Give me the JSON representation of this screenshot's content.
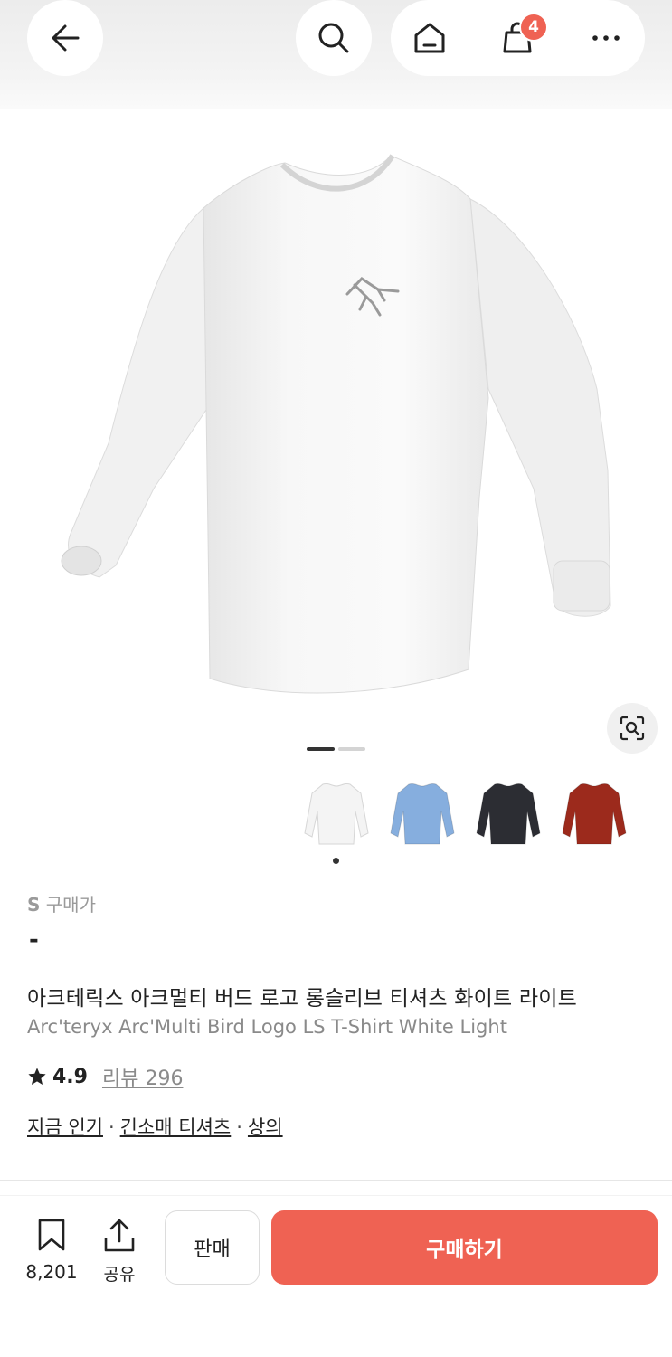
{
  "header": {
    "cart_count": "4",
    "icons": [
      "arrow-left-icon",
      "search-icon",
      "home-icon",
      "shopping-bag-icon",
      "more-icon"
    ]
  },
  "gallery": {
    "current_index": 1,
    "total": 2,
    "thumbnails": [
      {
        "color_name": "white",
        "color": "#f4f4f4"
      },
      {
        "color_name": "light-blue",
        "color": "#86aede"
      },
      {
        "color_name": "black",
        "color": "#2c2d33"
      },
      {
        "color_name": "red",
        "color": "#9c2a1c"
      }
    ],
    "selected_thumbnail": 0
  },
  "product": {
    "size_prefix": "S",
    "size_suffix": "구매가",
    "price": "-",
    "title_ko": "아크테릭스 아크멀티 버드 로고 롱슬리브 티셔츠 화이트 라이트",
    "title_en": "Arc'teryx Arc'Multi Bird Logo LS T-Shirt White Light",
    "rating": "4.9",
    "review_label": "리뷰 296",
    "categories": [
      "지금 인기",
      "긴소매 티셔츠",
      "상의"
    ],
    "category_separator": "·"
  },
  "bottom_bar": {
    "save_count": "8,201",
    "share_label": "공유",
    "sell_label": "판매",
    "buy_label": "구매하기"
  },
  "colors": {
    "accent": "#ef6253"
  }
}
